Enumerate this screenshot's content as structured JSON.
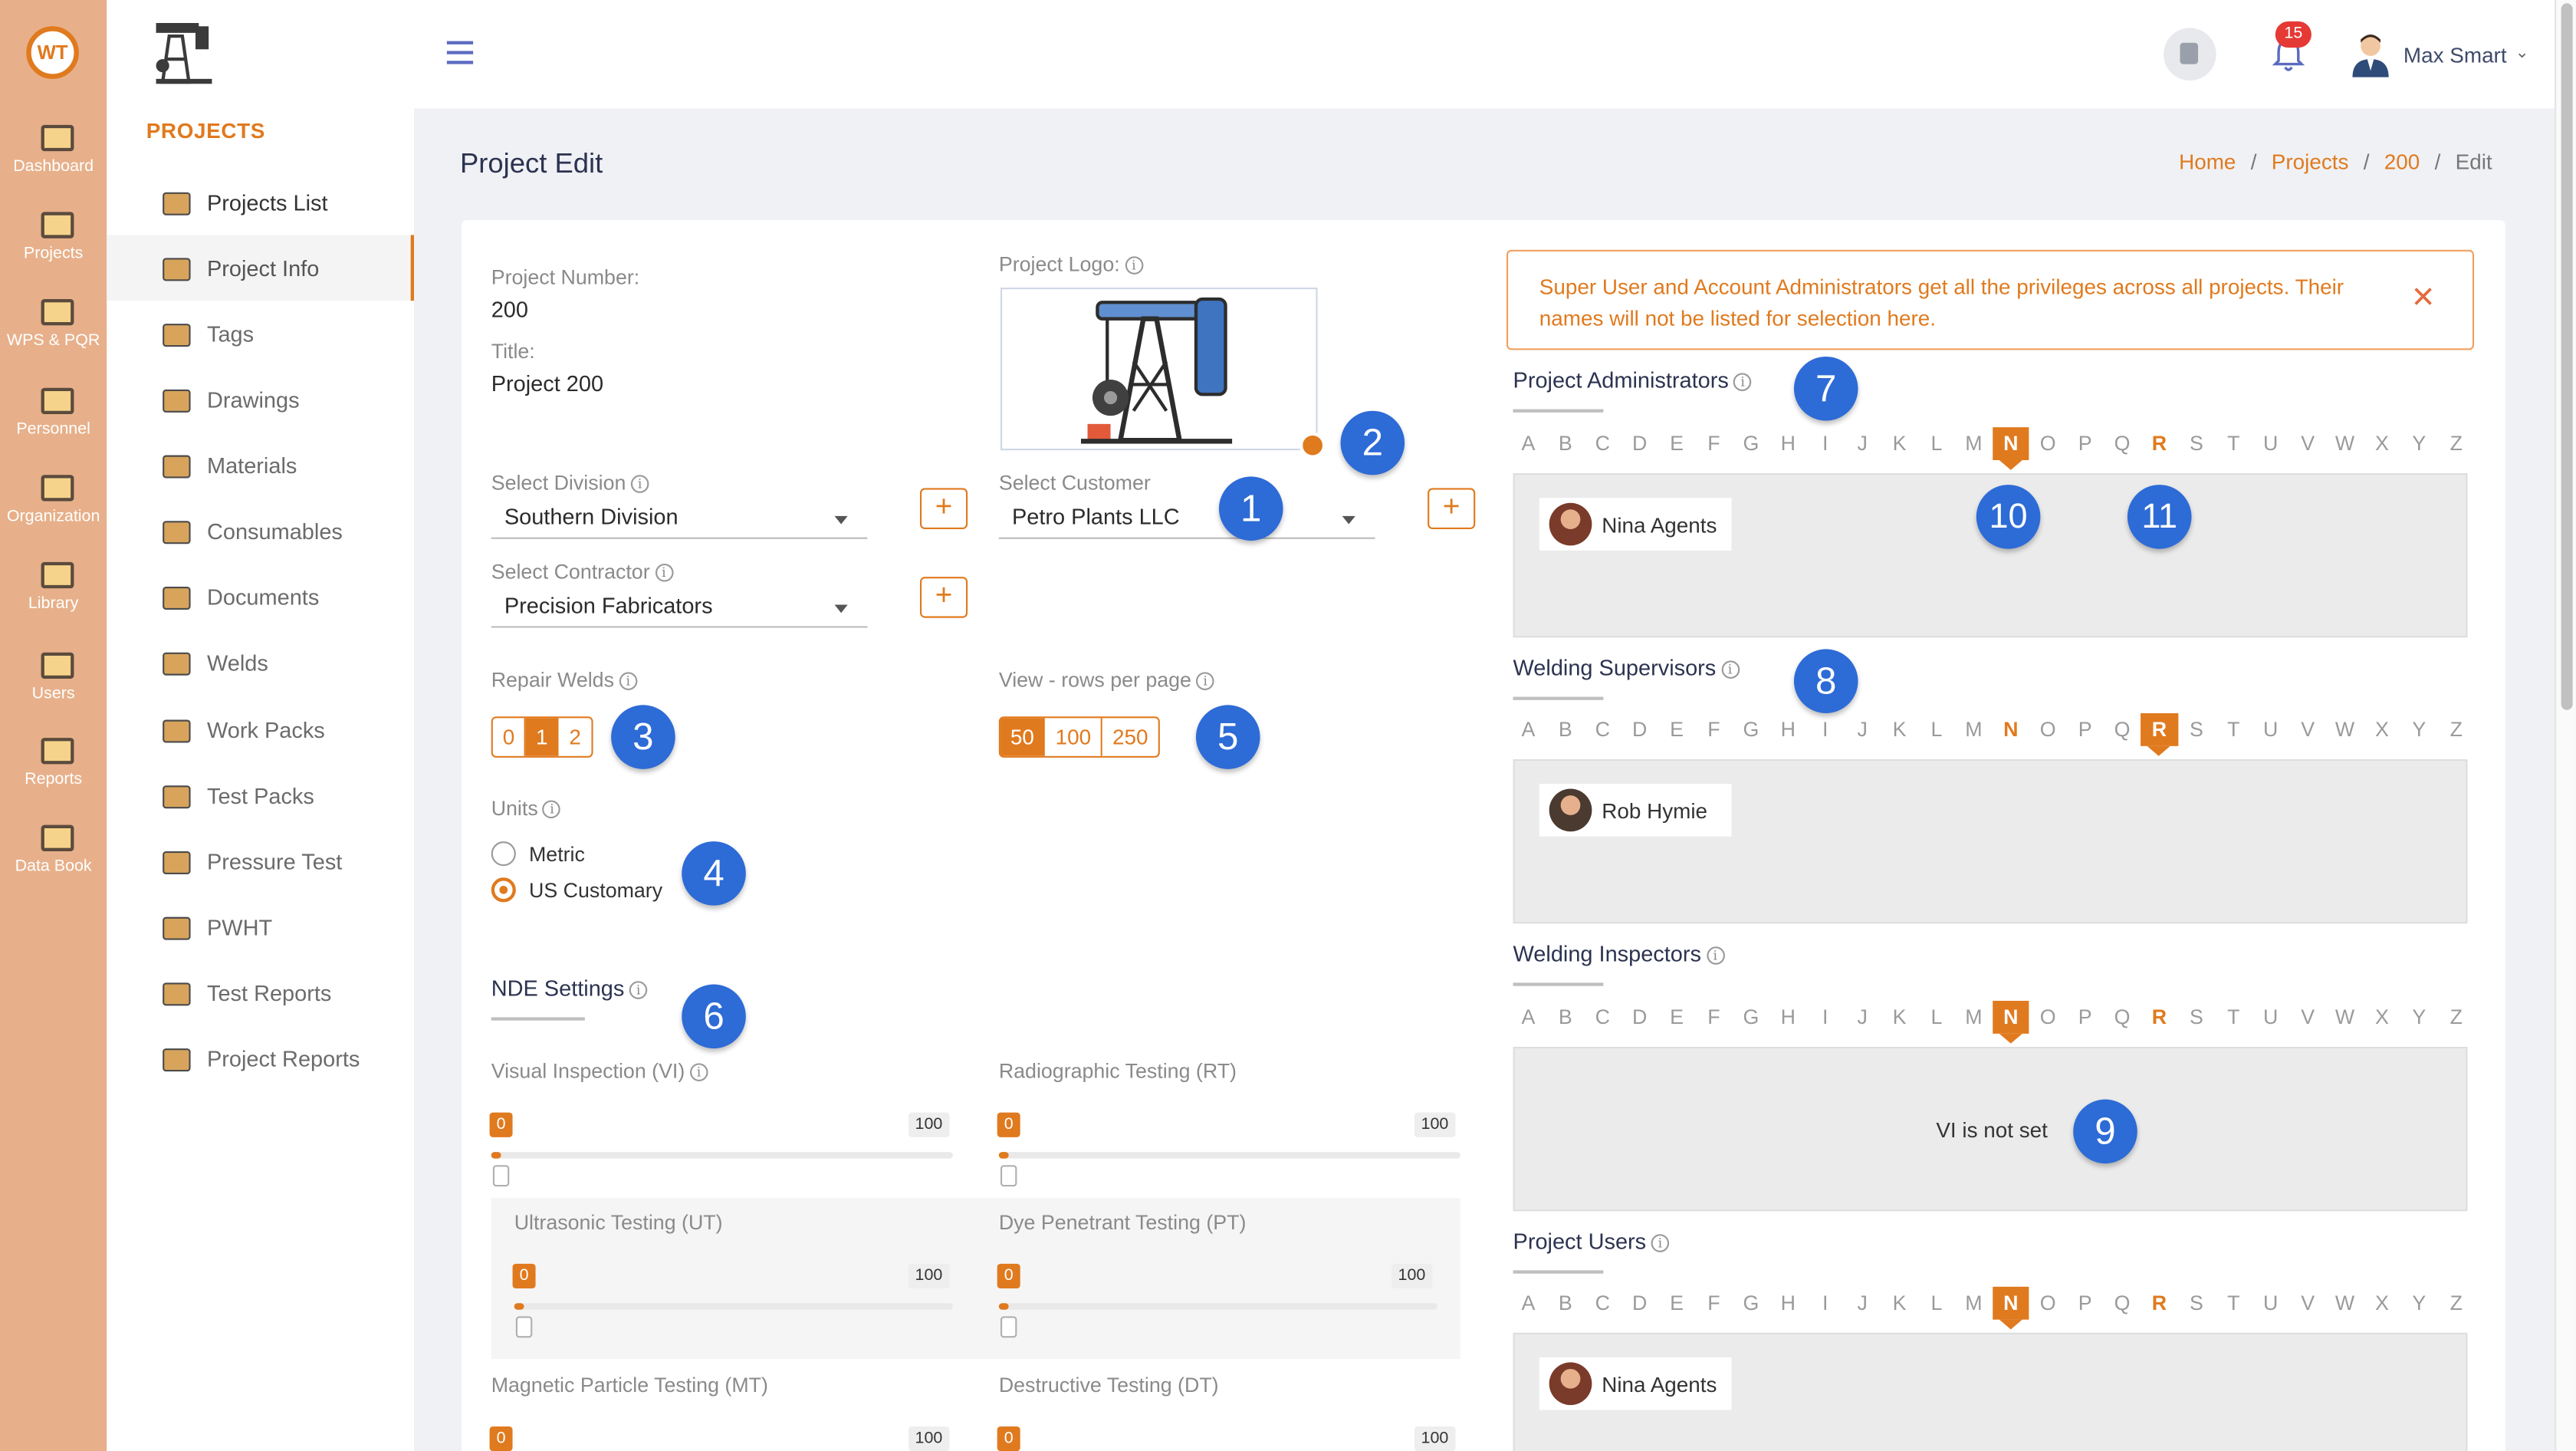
{
  "app": {
    "rail": [
      {
        "label": "Dashboard",
        "icon": "dashboard-icon"
      },
      {
        "label": "Projects",
        "icon": "projects-icon"
      },
      {
        "label": "WPS & PQR",
        "icon": "wps-pqr-icon"
      },
      {
        "label": "Personnel",
        "icon": "personnel-icon"
      },
      {
        "label": "Organization",
        "icon": "organization-icon"
      },
      {
        "label": "Library",
        "icon": "library-icon"
      },
      {
        "label": "Users",
        "icon": "users-icon"
      },
      {
        "label": "Reports",
        "icon": "reports-icon"
      },
      {
        "label": "Data Book",
        "icon": "data-book-icon"
      }
    ],
    "rail_logo": "WT",
    "brand_color": "#e07a1e"
  },
  "sidebar": {
    "title": "PROJECTS",
    "items": [
      {
        "label": "Projects List"
      },
      {
        "label": "Project Info"
      },
      {
        "label": "Tags"
      },
      {
        "label": "Drawings"
      },
      {
        "label": "Materials"
      },
      {
        "label": "Consumables"
      },
      {
        "label": "Documents"
      },
      {
        "label": "Welds"
      },
      {
        "label": "Work Packs"
      },
      {
        "label": "Test Packs"
      },
      {
        "label": "Pressure Test"
      },
      {
        "label": "PWHT"
      },
      {
        "label": "Test Reports"
      },
      {
        "label": "Project Reports"
      }
    ]
  },
  "header": {
    "notification_count": "15",
    "user_name": "Max Smart"
  },
  "page": {
    "title": "Project Edit",
    "breadcrumb": {
      "home": "Home",
      "projects": "Projects",
      "id": "200",
      "current": "Edit"
    }
  },
  "form": {
    "project_number_label": "Project Number:",
    "project_number": "200",
    "title_label": "Title:",
    "title": "Project 200",
    "logo_label": "Project Logo:",
    "division_label": "Select Division",
    "division": "Southern Division",
    "customer_label": "Select Customer",
    "customer": "Petro Plants LLC",
    "contractor_label": "Select Contractor",
    "contractor": "Precision Fabricators",
    "plus": "+",
    "repair_label": "Repair Welds",
    "repair_options": [
      "0",
      "1",
      "2"
    ],
    "repair_selected": "1",
    "rows_label": "View - rows per page",
    "rows_options": [
      "50",
      "100",
      "250"
    ],
    "rows_selected": "50",
    "units_label": "Units",
    "units_options": [
      "Metric",
      "US Customary"
    ],
    "units_selected": "US Customary",
    "nde_title": "NDE Settings",
    "nde": [
      {
        "label": "Visual Inspection (VI)",
        "min": "0",
        "max": "100",
        "value": 0
      },
      {
        "label": "Radiographic Testing (RT)",
        "min": "0",
        "max": "100",
        "value": 0
      },
      {
        "label": "Ultrasonic Testing (UT)",
        "min": "0",
        "max": "100",
        "value": 0
      },
      {
        "label": "Dye Penetrant Testing (PT)",
        "min": "0",
        "max": "100",
        "value": 0
      },
      {
        "label": "Magnetic Particle Testing (MT)",
        "min": "0",
        "max": "100",
        "value": 0
      },
      {
        "label": "Destructive Testing (DT)",
        "min": "0",
        "max": "100",
        "value": 0
      }
    ]
  },
  "roles": {
    "alert": "Super User and Account Administrators get all the privileges across all projects. Their names will not be listed for selection here.",
    "letters": [
      "A",
      "B",
      "C",
      "D",
      "E",
      "F",
      "G",
      "H",
      "I",
      "J",
      "K",
      "L",
      "M",
      "N",
      "O",
      "P",
      "Q",
      "R",
      "S",
      "T",
      "U",
      "V",
      "W",
      "X",
      "Y",
      "Z"
    ],
    "sections": [
      {
        "title": "Project Administrators",
        "selected": "N",
        "highlight": [
          "N",
          "R"
        ],
        "member": "Nina Agents"
      },
      {
        "title": "Welding Supervisors",
        "selected": "R",
        "highlight": [
          "N",
          "R"
        ],
        "member": "Rob Hymie"
      },
      {
        "title": "Welding Inspectors",
        "selected": "N",
        "highlight": [
          "N",
          "R"
        ],
        "empty": "VI is not set"
      },
      {
        "title": "Project Users",
        "selected": "N",
        "highlight": [
          "N",
          "R"
        ],
        "member": "Nina Agents"
      }
    ]
  },
  "markers": [
    "1",
    "2",
    "3",
    "4",
    "5",
    "6",
    "7",
    "8",
    "9",
    "10",
    "11"
  ]
}
